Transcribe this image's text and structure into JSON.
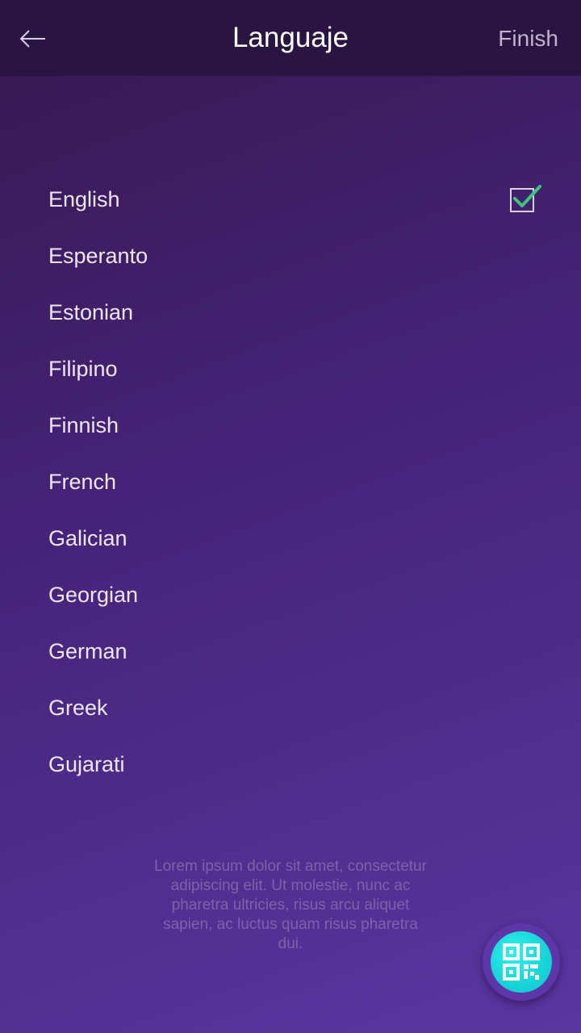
{
  "header": {
    "back_icon": "arrow-left-icon",
    "title": "Languaje",
    "finish_label": "Finish"
  },
  "languages": {
    "selected": "English",
    "items": [
      {
        "label": "English",
        "selected": true
      },
      {
        "label": "Esperanto",
        "selected": false
      },
      {
        "label": "Estonian",
        "selected": false
      },
      {
        "label": "Filipino",
        "selected": false
      },
      {
        "label": "Finnish",
        "selected": false
      },
      {
        "label": "French",
        "selected": false
      },
      {
        "label": "Galician",
        "selected": false
      },
      {
        "label": "Georgian",
        "selected": false
      },
      {
        "label": "German",
        "selected": false
      },
      {
        "label": "Greek",
        "selected": false
      },
      {
        "label": "Gujarati",
        "selected": false
      }
    ]
  },
  "footer": {
    "text": "Lorem ipsum dolor sit amet, consectetur adipiscing elit. Ut molestie, nunc ac pharetra ultricies, risus arcu aliquet sapien, ac luctus quam risus pharetra dui."
  },
  "fab": {
    "icon": "qr-code-icon"
  },
  "colors": {
    "background_top": "#37184f",
    "background_bottom": "#5a36a1",
    "header_bg": "#2a1441",
    "check_color": "#3ec47a",
    "fab_accent": "#1ad8da"
  }
}
